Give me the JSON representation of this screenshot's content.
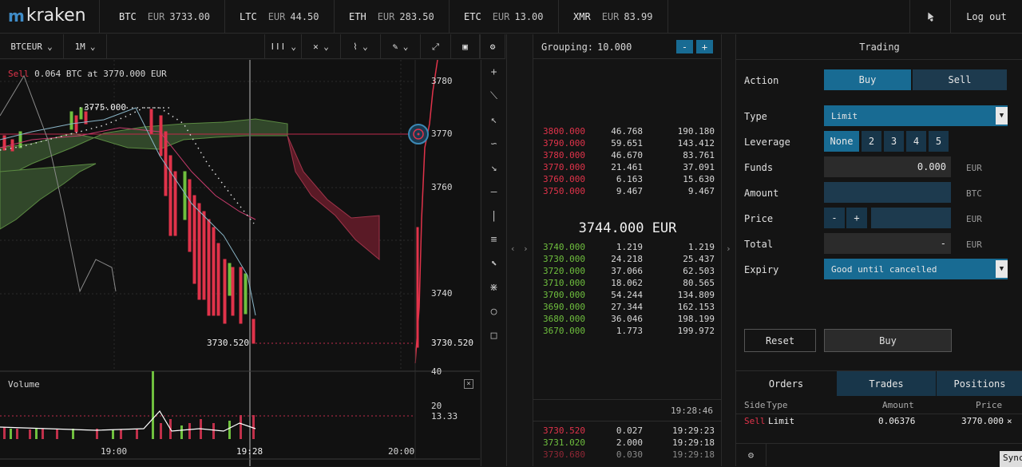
{
  "brand": {
    "name": "kraken"
  },
  "tickers": [
    {
      "symbol": "BTC",
      "currency": "EUR",
      "price": "3733.00"
    },
    {
      "symbol": "LTC",
      "currency": "EUR",
      "price": "44.50"
    },
    {
      "symbol": "ETH",
      "currency": "EUR",
      "price": "283.50"
    },
    {
      "symbol": "ETC",
      "currency": "EUR",
      "price": "13.00"
    },
    {
      "symbol": "XMR",
      "currency": "EUR",
      "price": "83.99"
    }
  ],
  "header": {
    "logout_label": "Log out",
    "notify_icon": "bell-icon"
  },
  "chart_toolbar": {
    "pair": "BTCEUR",
    "interval": "1M",
    "icons": [
      "candles-icon",
      "crosshair-icon",
      "indicator-icon",
      "pencil-icon",
      "expand-icon",
      "screenshot-icon",
      "gear-icon"
    ]
  },
  "chart": {
    "order_label_side": "Sell",
    "order_label_text": "0.064 BTC at 3770.000 EUR",
    "high_label": "3775.000",
    "low_label": "3730.520",
    "price_ticks": [
      "3780",
      "3770",
      "3760",
      "3740"
    ],
    "current_price_tag": "3730.520",
    "volume_title": "Volume",
    "volume_ticks": [
      "40",
      "20",
      "13.33"
    ],
    "time_ticks": [
      "19:00",
      "19:28",
      "20:00"
    ],
    "sell_order_color": "#e0334a",
    "buy_color": "#6fbf3e"
  },
  "side_tools": [
    "plus-icon",
    "line-icon",
    "ray-icon",
    "curve-icon",
    "arrow-icon",
    "horizontal-line-icon",
    "vertical-line-icon",
    "parallel-lines-icon",
    "pointer-icon",
    "fibonacci-icon",
    "circle-icon",
    "square-icon"
  ],
  "orderbook": {
    "grouping_label": "Grouping:",
    "grouping_value": "10.000",
    "minus": "-",
    "plus": "+",
    "asks": [
      {
        "price": "3800.000",
        "amount": "46.768",
        "total": "190.180"
      },
      {
        "price": "3790.000",
        "amount": "59.651",
        "total": "143.412"
      },
      {
        "price": "3780.000",
        "amount": "46.670",
        "total": "83.761"
      },
      {
        "price": "3770.000",
        "amount": "21.461",
        "total": "37.091"
      },
      {
        "price": "3760.000",
        "amount": "6.163",
        "total": "15.630"
      },
      {
        "price": "3750.000",
        "amount": "9.467",
        "total": "9.467"
      }
    ],
    "mid_price": "3744.000 EUR",
    "bids": [
      {
        "price": "3740.000",
        "amount": "1.219",
        "total": "1.219"
      },
      {
        "price": "3730.000",
        "amount": "24.218",
        "total": "25.437"
      },
      {
        "price": "3720.000",
        "amount": "37.066",
        "total": "62.503"
      },
      {
        "price": "3710.000",
        "amount": "18.062",
        "total": "80.565"
      },
      {
        "price": "3700.000",
        "amount": "54.244",
        "total": "134.809"
      },
      {
        "price": "3690.000",
        "amount": "27.344",
        "total": "162.153"
      },
      {
        "price": "3680.000",
        "amount": "36.046",
        "total": "198.199"
      },
      {
        "price": "3670.000",
        "amount": "1.773",
        "total": "199.972"
      }
    ],
    "clock": "19:28:46",
    "trades": [
      {
        "price": "3730.520",
        "amount": "0.027",
        "time": "19:29:23",
        "side": "sell"
      },
      {
        "price": "3731.020",
        "amount": "2.000",
        "time": "19:29:18",
        "side": "buy"
      },
      {
        "price": "3730.680",
        "amount": "0.030",
        "time": "19:29:18",
        "side": "sell"
      }
    ]
  },
  "trading": {
    "title": "Trading",
    "action_label": "Action",
    "buy_label": "Buy",
    "sell_label": "Sell",
    "type_label": "Type",
    "type_value": "Limit",
    "leverage_label": "Leverage",
    "leverage_options": [
      "None",
      "2",
      "3",
      "4",
      "5"
    ],
    "funds_label": "Funds",
    "funds_value": "0.000",
    "funds_unit": "EUR",
    "amount_label": "Amount",
    "amount_value": "",
    "amount_unit": "BTC",
    "price_label": "Price",
    "price_minus": "-",
    "price_plus": "+",
    "price_value": "",
    "price_unit": "EUR",
    "total_label": "Total",
    "total_value": "-",
    "total_unit": "EUR",
    "expiry_label": "Expiry",
    "expiry_value": "Good until cancelled",
    "reset_label": "Reset",
    "submit_label": "Buy"
  },
  "bottom_tabs": {
    "orders": "Orders",
    "trades": "Trades",
    "positions": "Positions",
    "columns": {
      "side": "Side",
      "type": "Type",
      "amount": "Amount",
      "price": "Price"
    },
    "rows": [
      {
        "side": "Sell",
        "type": "Limit",
        "amount": "0.06376",
        "price": "3770.000",
        "close": "×"
      }
    ],
    "sync_label": "Sync"
  }
}
